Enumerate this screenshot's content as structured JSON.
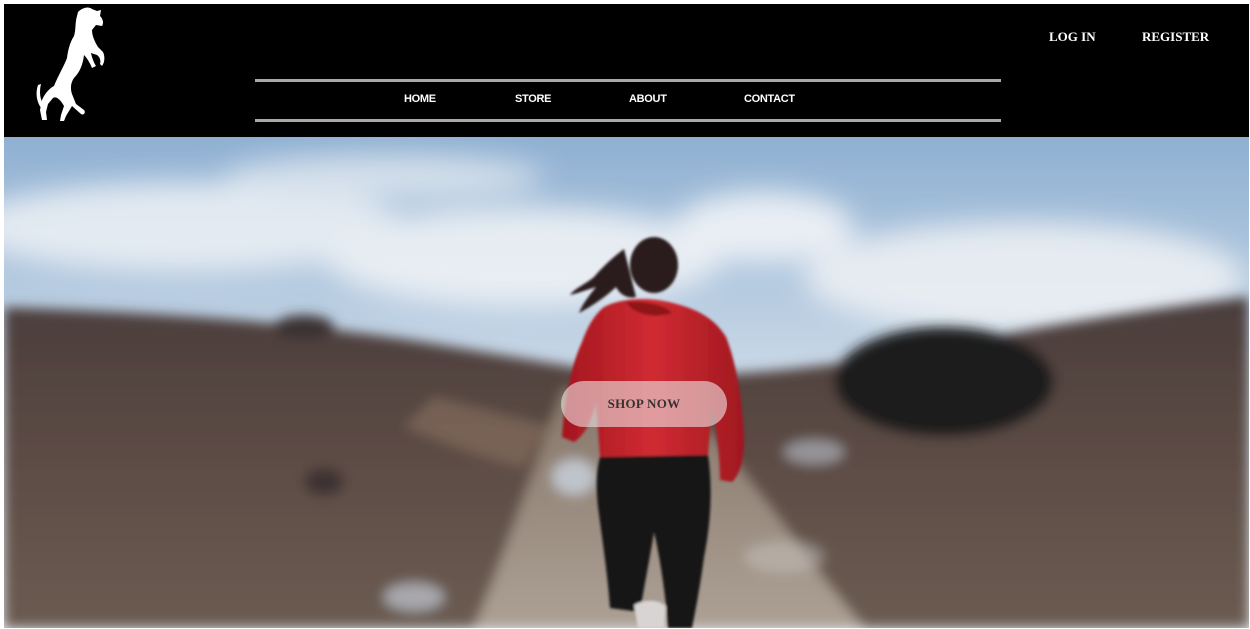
{
  "header": {
    "logo_icon": "rearing-horse-icon",
    "nav": {
      "home": "HOME",
      "store": "STORE",
      "about": "ABOUT",
      "contact": "CONTACT"
    },
    "auth": {
      "login": "LOG IN",
      "register": "REGISTER"
    }
  },
  "hero": {
    "image": "woman-running-on-dirt-road-photo",
    "cta": "SHOP NOW"
  },
  "colors": {
    "header_bg": "#000000",
    "nav_rule": "#a8a8a8",
    "jacket_red": "#c4202a",
    "sky": "#a9c3dc"
  }
}
